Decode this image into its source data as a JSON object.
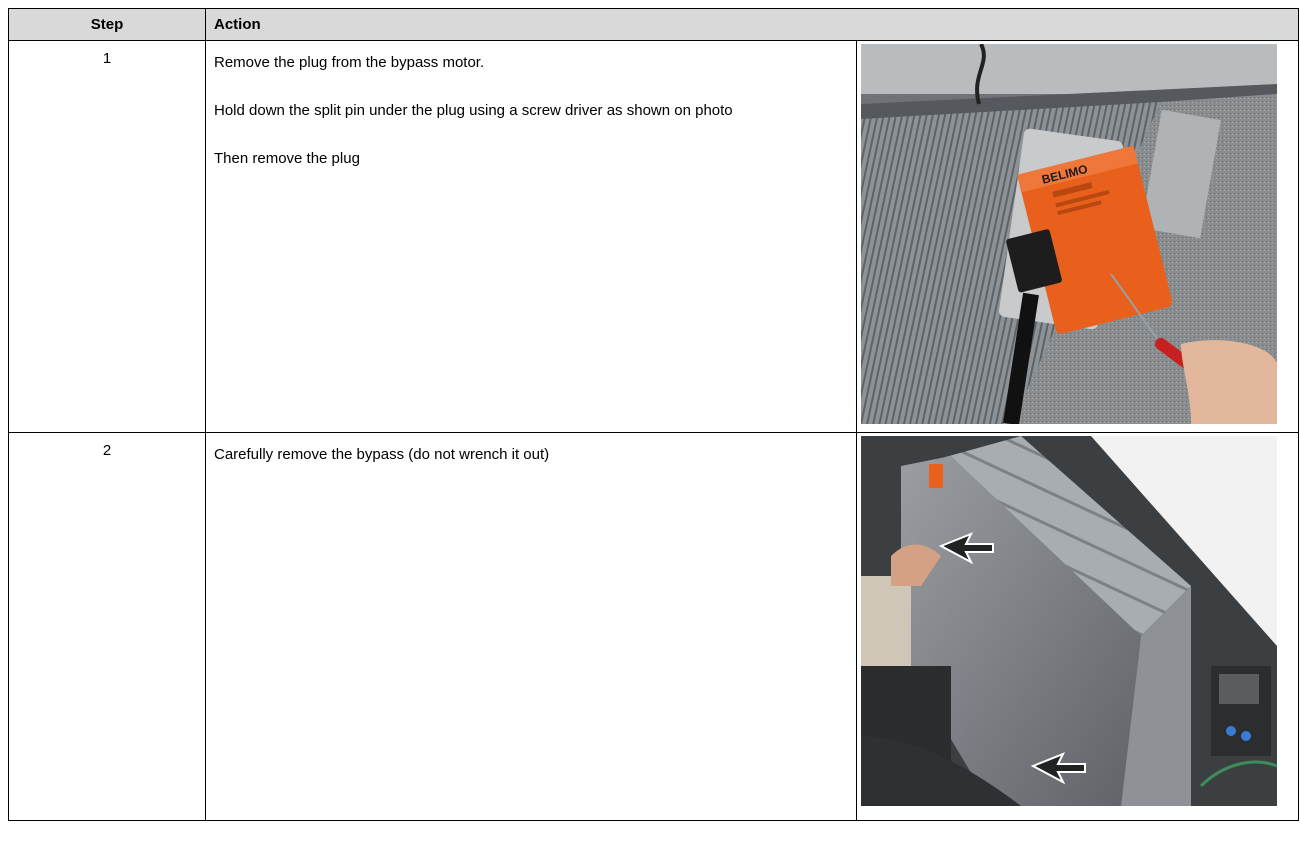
{
  "table": {
    "headers": {
      "step": "Step",
      "action": "Action"
    },
    "rows": [
      {
        "step": "1",
        "lines": [
          "Remove the plug from the bypass motor.",
          "Hold down the split pin under the plug using a screw driver as shown on photo",
          "Then remove the plug"
        ],
        "photo_text": "BELIMO"
      },
      {
        "step": "2",
        "lines": [
          "Carefully remove the bypass (do not wrench it out)"
        ]
      }
    ]
  },
  "colors": {
    "header_bg": "#d9d9d9",
    "motor_orange": "#e8601c",
    "arrow": "#222222"
  }
}
